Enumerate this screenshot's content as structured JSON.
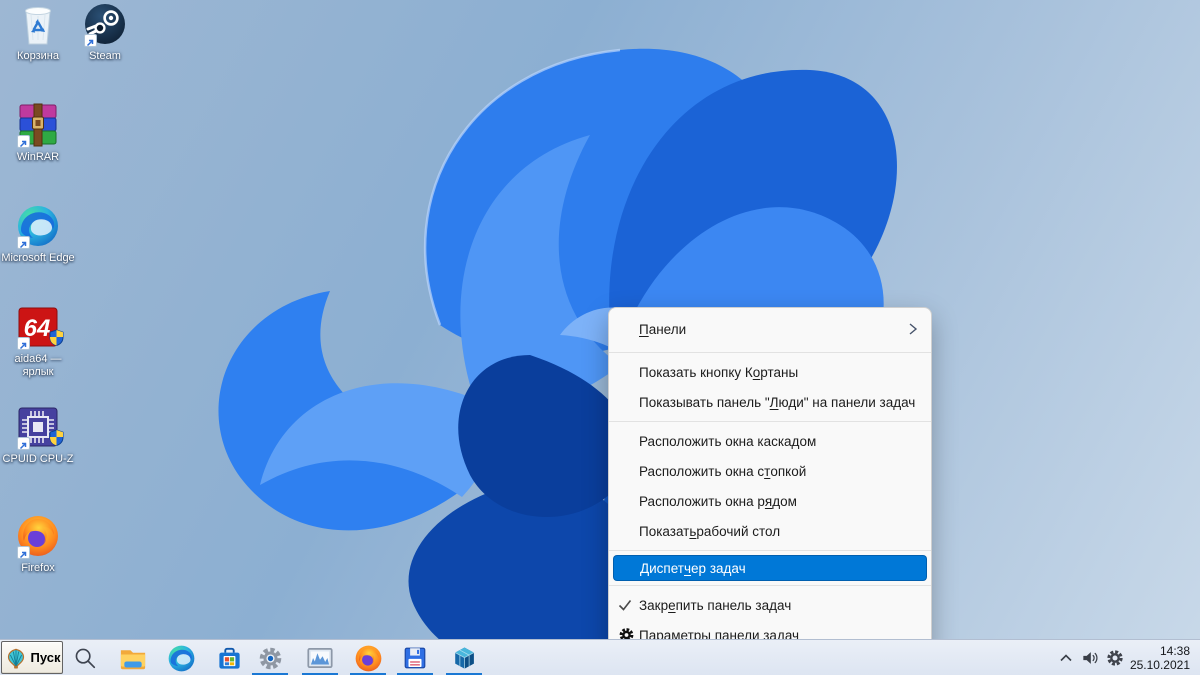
{
  "desktop": {
    "icons": [
      {
        "name": "recycle-bin",
        "label": "Корзина"
      },
      {
        "name": "steam",
        "label": "Steam"
      },
      {
        "name": "winrar",
        "label": "WinRAR"
      },
      {
        "name": "microsoft-edge",
        "label": "Microsoft Edge"
      },
      {
        "name": "aida64",
        "label": "aida64 — ярлык"
      },
      {
        "name": "cpuid-cpu-z",
        "label": "CPUID CPU-Z"
      },
      {
        "name": "firefox",
        "label": "Firefox"
      }
    ]
  },
  "context_menu": {
    "accent_color": "#0078d7",
    "items": [
      {
        "pre": "",
        "key": "П",
        "post": "анели",
        "submenu": true
      },
      {
        "pre": "Показать кнопку К",
        "key": "о",
        "post": "ртаны"
      },
      {
        "pre": "Показывать панель \"",
        "key": "Л",
        "post": "юди\" на панели задач"
      },
      {
        "pre": "Расположить окна каскадом",
        "key": "",
        "post": ""
      },
      {
        "pre": "Расположить окна с",
        "key": "т",
        "post": "опкой"
      },
      {
        "pre": "Расположить окна р",
        "key": "я",
        "post": "дом"
      },
      {
        "pre": "Показат",
        "key": "ь",
        "post": " рабочий стол"
      },
      {
        "pre": "Диспет",
        "key": "ч",
        "post": "ер задач",
        "highlighted": true
      },
      {
        "pre": "Закр",
        "key": "е",
        "post": "пить панель задач",
        "checked": true
      },
      {
        "pre": "Параметры па",
        "key": "н",
        "post": "ели задач",
        "icon": "gear"
      }
    ]
  },
  "taskbar": {
    "start_label": "Пуск",
    "running_indicator_color": "#1a78d4",
    "buttons": [
      {
        "name": "search",
        "running": false
      },
      {
        "name": "file-explorer",
        "running": false
      },
      {
        "name": "microsoft-edge",
        "running": false
      },
      {
        "name": "microsoft-store",
        "running": false
      },
      {
        "name": "settings",
        "running": true
      },
      {
        "name": "system-monitor",
        "running": true
      },
      {
        "name": "firefox",
        "running": true
      },
      {
        "name": "floppy-save-app",
        "running": true
      },
      {
        "name": "registry-editor",
        "running": true
      }
    ],
    "tray": {
      "time": "14:38",
      "date": "25.10.2021"
    }
  }
}
